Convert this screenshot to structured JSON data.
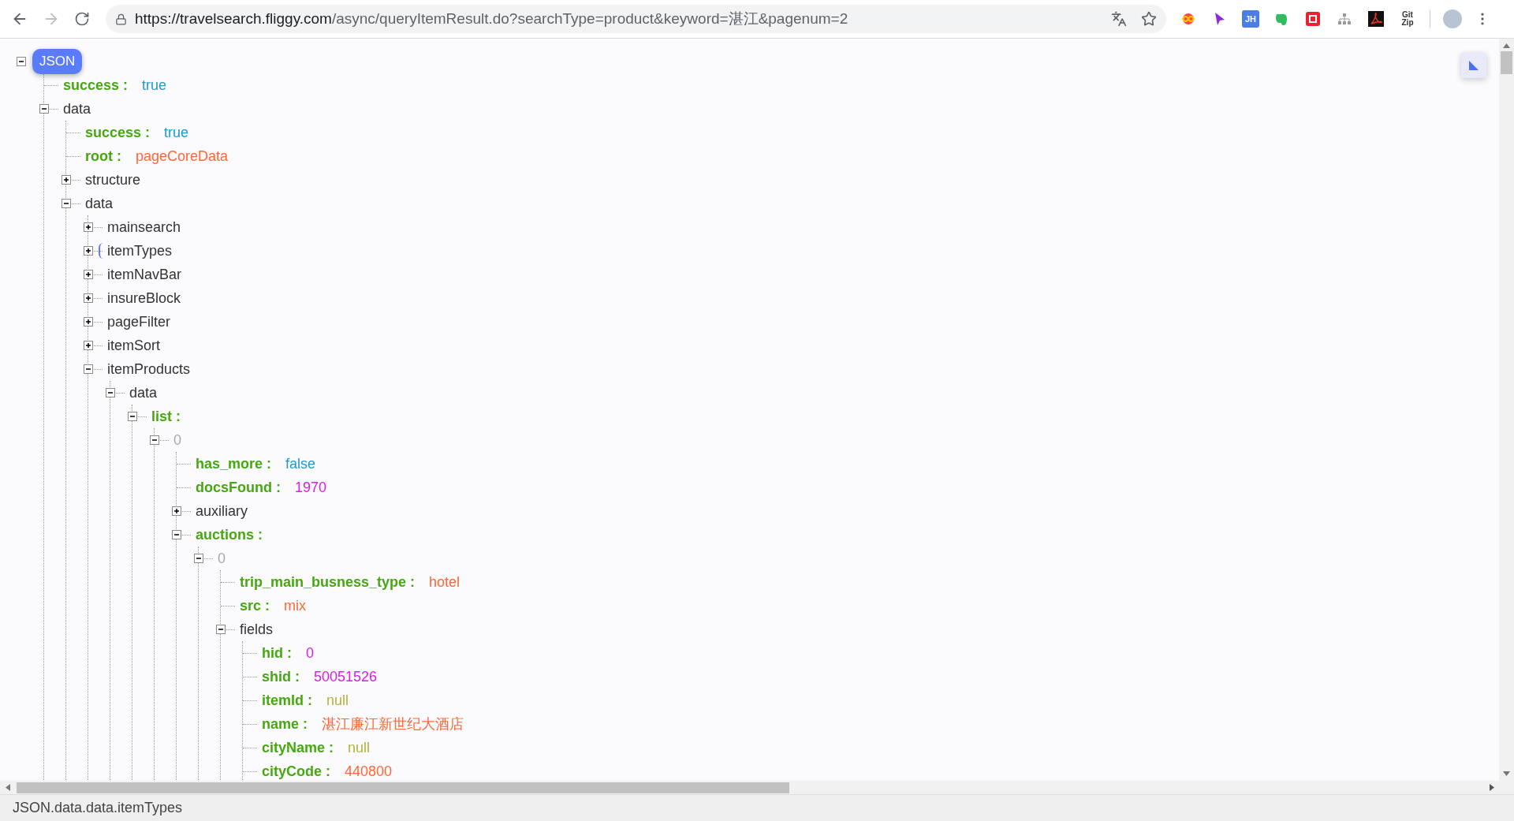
{
  "toolbar": {
    "url_host": "https://travelsearch.fliggy.com",
    "url_path": "/async/queryItemResult.do?searchType=product&keyword=湛江&pagenum=2",
    "extension_jh": "JH",
    "extension_gitzip": "Git Zip"
  },
  "tree": {
    "label": "JSON",
    "expanded": true,
    "children": [
      {
        "kind": "boolean",
        "key": "success :",
        "value": "true"
      },
      {
        "kind": "object",
        "key": "data",
        "expanded": true,
        "selected": false,
        "children": [
          {
            "kind": "boolean",
            "key": "success :",
            "value": "true"
          },
          {
            "kind": "string",
            "key": "root :",
            "value": "pageCoreData"
          },
          {
            "kind": "object",
            "key": "structure",
            "expanded": false,
            "selected": false
          },
          {
            "kind": "object",
            "key": "data",
            "expanded": true,
            "selected": false,
            "children": [
              {
                "kind": "object",
                "key": "mainsearch",
                "expanded": false,
                "selected": false
              },
              {
                "kind": "object",
                "key": "itemTypes",
                "expanded": false,
                "selected": true
              },
              {
                "kind": "object",
                "key": "itemNavBar",
                "expanded": false,
                "selected": false
              },
              {
                "kind": "object",
                "key": "insureBlock",
                "expanded": false,
                "selected": false
              },
              {
                "kind": "object",
                "key": "pageFilter",
                "expanded": false,
                "selected": false
              },
              {
                "kind": "object",
                "key": "itemSort",
                "expanded": false,
                "selected": false
              },
              {
                "kind": "object",
                "key": "itemProducts",
                "expanded": true,
                "selected": false,
                "children": [
                  {
                    "kind": "object",
                    "key": "data",
                    "expanded": true,
                    "selected": false,
                    "children": [
                      {
                        "kind": "array",
                        "key": "list :",
                        "expanded": true,
                        "selected": false,
                        "children": [
                          {
                            "kind": "index",
                            "key": "0",
                            "expanded": true,
                            "selected": false,
                            "children": [
                              {
                                "kind": "boolean",
                                "key": "has_more :",
                                "value": "false"
                              },
                              {
                                "kind": "number",
                                "key": "docsFound :",
                                "value": "1970"
                              },
                              {
                                "kind": "object",
                                "key": "auxiliary",
                                "expanded": false,
                                "selected": false
                              },
                              {
                                "kind": "array",
                                "key": "auctions :",
                                "expanded": true,
                                "selected": false,
                                "children": [
                                  {
                                    "kind": "index",
                                    "key": "0",
                                    "expanded": true,
                                    "selected": false,
                                    "children": [
                                      {
                                        "kind": "string",
                                        "key": "trip_main_busness_type :",
                                        "value": "hotel"
                                      },
                                      {
                                        "kind": "string",
                                        "key": "src :",
                                        "value": "mix"
                                      },
                                      {
                                        "kind": "object",
                                        "key": "fields",
                                        "expanded": true,
                                        "selected": false,
                                        "children": [
                                          {
                                            "kind": "number",
                                            "key": "hid :",
                                            "value": "0"
                                          },
                                          {
                                            "kind": "number",
                                            "key": "shid :",
                                            "value": "50051526"
                                          },
                                          {
                                            "kind": "null",
                                            "key": "itemId :",
                                            "value": "null"
                                          },
                                          {
                                            "kind": "string",
                                            "key": "name :",
                                            "value": "湛江廉江新世纪大酒店"
                                          },
                                          {
                                            "kind": "null",
                                            "key": "cityName :",
                                            "value": "null"
                                          },
                                          {
                                            "kind": "string",
                                            "key": "cityCode :",
                                            "value": "440800"
                                          }
                                        ]
                                      }
                                    ]
                                  }
                                ]
                              }
                            ]
                          }
                        ]
                      }
                    ]
                  }
                ]
              }
            ]
          }
        ]
      }
    ]
  },
  "status_bar": {
    "path": "JSON.data.data.itemTypes"
  }
}
